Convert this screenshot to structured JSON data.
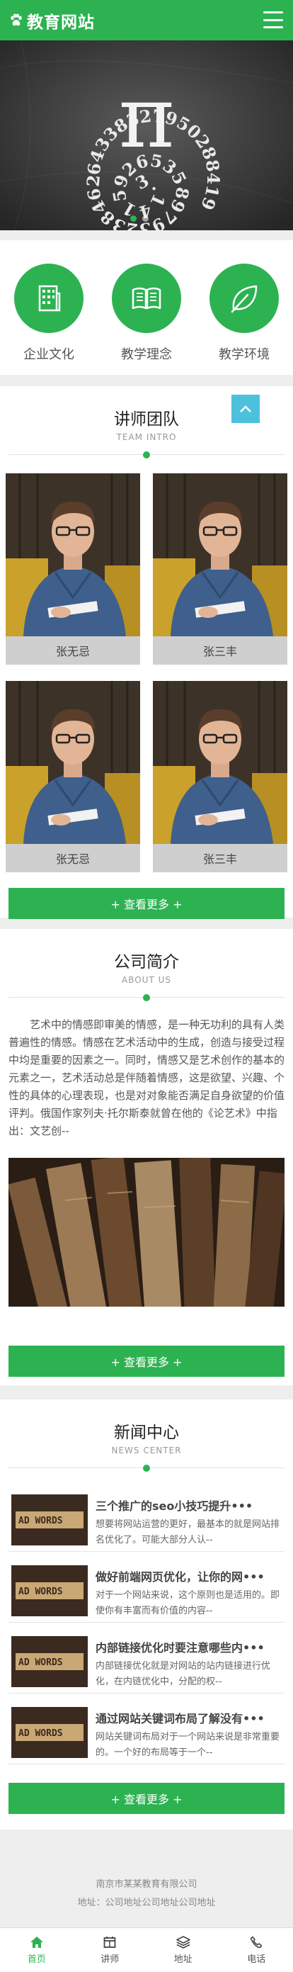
{
  "header": {
    "title": "教育网站"
  },
  "banner": {
    "slides": 2,
    "active": 0,
    "digits": "3.1415926535897932384626433"
  },
  "features": [
    {
      "label": "企业文化",
      "icon": "building-icon"
    },
    {
      "label": "教学理念",
      "icon": "book-icon"
    },
    {
      "label": "教学环境",
      "icon": "leaf-icon"
    }
  ],
  "team": {
    "title": "讲师团队",
    "subtitle": "TEAM INTRO",
    "members": [
      {
        "name": "张无忌"
      },
      {
        "name": "张三丰"
      },
      {
        "name": "张无忌"
      },
      {
        "name": "张三丰"
      }
    ],
    "more": "+ 查看更多 +"
  },
  "about": {
    "title": "公司简介",
    "subtitle": "ABOUT US",
    "text": "艺术中的情感即审美的情感，是一种无功利的具有人类普遍性的情感。情感在艺术活动中的生成，创造与接受过程中均是重要的因素之一。同时，情感又是艺术创作的基本的元素之一，艺术活动总是伴随着情感，这是欲望、兴趣、个性的具体的心理表现，也是对对象能否满足自身欲望的价值评判。俄国作家列夫·托尔斯泰就曾在他的《论艺术》中指出：文艺创--",
    "more": "+ 查看更多 +"
  },
  "news": {
    "title": "新闻中心",
    "subtitle": "NEWS CENTER",
    "items": [
      {
        "title": "三个推广的seo小技巧提升•••",
        "desc": "想要将网站运营的更好，最基本的就是网站排名优化了。可能大部分人认--"
      },
      {
        "title": "做好前端网页优化，让你的网•••",
        "desc": "对于一个网站来说，这个原则也是适用的。即使你有丰富而有价值的内容--"
      },
      {
        "title": "内部链接优化时要注意哪些内•••",
        "desc": "内部链接优化就是对网站的站内链接进行优化，在内链优化中，分配的权--"
      },
      {
        "title": "通过网站关键词布局了解没有•••",
        "desc": "网站关键词布局对于一个网站来说是非常重要的。一个好的布局等于一个--"
      }
    ],
    "thumb_text": "AD WORDS",
    "more": "+ 查看更多 +"
  },
  "footer": {
    "company": "南京市某某教育有限公司",
    "address": "地址：公司地址公司地址公司地址"
  },
  "bottom_nav": [
    {
      "label": "首页",
      "icon": "home-icon",
      "active": true
    },
    {
      "label": "讲师",
      "icon": "calendar-icon",
      "active": false
    },
    {
      "label": "地址",
      "icon": "layers-icon",
      "active": false
    },
    {
      "label": "电话",
      "icon": "phone-icon",
      "active": false
    }
  ],
  "colors": {
    "brand": "#2db252",
    "totop": "#4dc1dc"
  }
}
